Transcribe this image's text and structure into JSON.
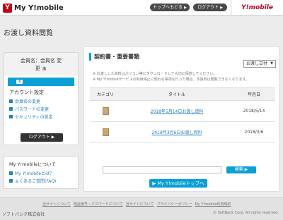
{
  "header": {
    "logo_text": "My Y!mobile",
    "logo_mark": "Y",
    "top_button": "トップへもどる",
    "logout_button": "ログアウト",
    "brand": "Y!mobile"
  },
  "page_title": "お渡し資料閲覧",
  "sidebar": {
    "member_label": "会員名：会員名 変",
    "member_label_2": "更 ぁ",
    "id_tag": "ID",
    "account_title": "アカウント設定",
    "links": [
      "会員名の変更",
      "パスワードの変更",
      "セキュリティの設定"
    ],
    "logout": "ログアウト",
    "info_title": "My Y!mobileについて",
    "info_links": [
      "My Y!mobileとは？",
      "よくあるご質問(FAQ)"
    ]
  },
  "main": {
    "section_title": "契約書・重要書類",
    "sort_label": "お渡し日付",
    "notes": [
      "お渡しした資料はパソコン等にダウンロードして大切に保管してください。",
      "My Y!mobileサービスの利用停止に関わる事項を行った場合、本資料は閲覧できなくなります。"
    ],
    "table": {
      "headers": [
        "カテゴリ",
        "タイトル",
        "年月日"
      ],
      "rows": [
        {
          "title": "2018年5月14日お渡し資料",
          "date": "2018/5/14"
        },
        {
          "title": "2018年3月6日お渡し資料",
          "date": "2018/3/6"
        }
      ]
    },
    "search_placeholder": "",
    "search_button": "検索",
    "top_button": "My Y!mobileトップへ"
  },
  "footer": {
    "links": [
      "当サイトについて",
      "暗証番号・パスワードについて",
      "当サイトについて",
      "プライバシーポリシー",
      "My Y!mobile利用規約"
    ],
    "company": "ソフトバンク株式会社",
    "copyright": "© SoftBank Corp. All rights reserved."
  }
}
